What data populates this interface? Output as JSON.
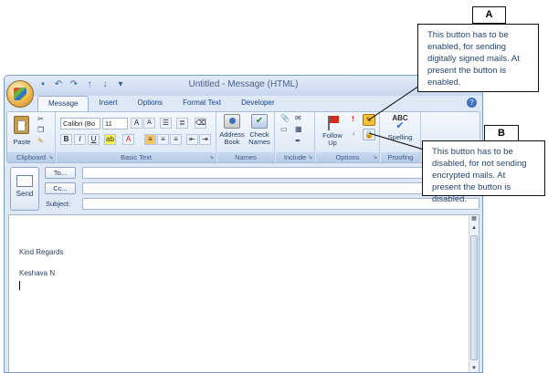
{
  "window": {
    "title": "Untitled - Message (HTML)",
    "controls": [
      "–",
      "□",
      "✕"
    ]
  },
  "tabs": [
    "Message",
    "Insert",
    "Options",
    "Format Text",
    "Developer"
  ],
  "help_label": "?",
  "ribbon": {
    "clipboard": {
      "label": "Clipboard",
      "paste": "Paste"
    },
    "basic_text": {
      "label": "Basic Text",
      "font": "Calibri (Bo",
      "size": "11"
    },
    "names": {
      "label": "Names",
      "address_book": "Address Book",
      "check_names": "Check Names"
    },
    "include": {
      "label": "Include"
    },
    "options": {
      "label": "Options",
      "follow_up": "Follow Up"
    },
    "proofing": {
      "label": "Proofing",
      "spelling": "Spelling",
      "abc": "ABC"
    }
  },
  "compose": {
    "send": "Send",
    "to": "To...",
    "cc": "Cc...",
    "subject": "Subject:"
  },
  "message_body": {
    "line1": "Kind Regards",
    "line2": "Keshava N"
  },
  "callouts": {
    "a": {
      "tag": "A",
      "text": "This button has to be enabled, for sending digitally signed mails. At present the button is enabled."
    },
    "b": {
      "tag": "B",
      "text": "This button has to be disabled, for not sending encrypted mails. At present the button is disabled."
    }
  }
}
